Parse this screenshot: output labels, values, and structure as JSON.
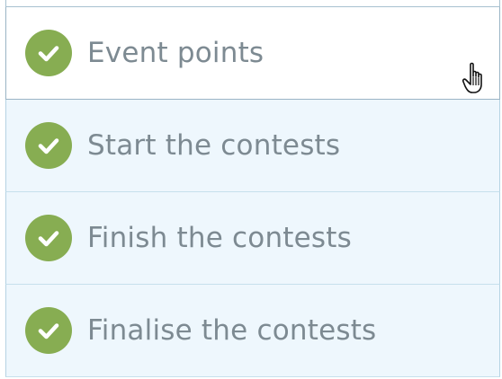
{
  "checklist": {
    "items": [
      {
        "label": "Event points",
        "status": "complete",
        "icon": "check-circle-icon",
        "hovered": true
      },
      {
        "label": "Start the contests",
        "status": "complete",
        "icon": "check-circle-icon"
      },
      {
        "label": "Finish the contests",
        "status": "complete",
        "icon": "check-circle-icon"
      },
      {
        "label": "Finalise the contests",
        "status": "complete",
        "icon": "check-circle-icon"
      }
    ]
  },
  "colors": {
    "check_fill": "#87ad52",
    "label_text": "#7d8a92",
    "item_background": "#eef7fd",
    "hover_background": "#ffffff",
    "border": "#b5d3e3"
  },
  "cursor": {
    "icon": "hand-pointer-icon"
  }
}
